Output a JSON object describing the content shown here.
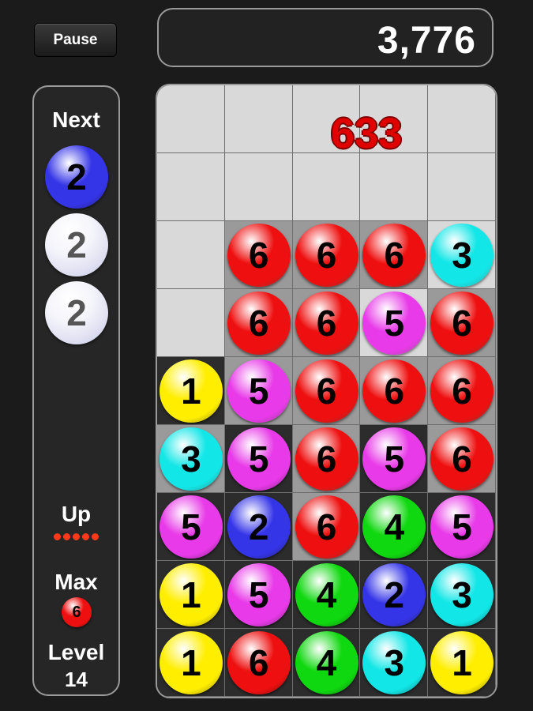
{
  "pause_label": "Pause",
  "score": "3,776",
  "popup_score": "633",
  "side": {
    "next_label": "Next",
    "next_balls": [
      "2",
      "2",
      "2"
    ],
    "up_label": "Up",
    "up_dots": 5,
    "max_label": "Max",
    "max_value": "6",
    "level_label": "Level",
    "level_value": "14"
  },
  "colors": {
    "1": "#ffee00",
    "2": "#3535e8",
    "3": "#12e6e6",
    "4": "#10d810",
    "5": "#e83ae8",
    "6": "#ee1010",
    "preview": "#dcdcf0"
  },
  "board": {
    "rows": 9,
    "cols": 5,
    "cells": [
      [
        null,
        null,
        null,
        null,
        null
      ],
      [
        null,
        null,
        null,
        null,
        null
      ],
      [
        null,
        "6",
        "6",
        "6",
        "3"
      ],
      [
        null,
        "6",
        "6",
        "5",
        "6"
      ],
      [
        "1",
        "5",
        "6",
        "6",
        "6"
      ],
      [
        "3",
        "5",
        "6",
        "5",
        "6"
      ],
      [
        "5",
        "2",
        "6",
        "4",
        "5"
      ],
      [
        "1",
        "5",
        "4",
        "2",
        "3"
      ],
      [
        "1",
        "6",
        "4",
        "3",
        "1"
      ]
    ],
    "cell_tones": [
      [
        "L",
        "L",
        "L",
        "L",
        "L"
      ],
      [
        "L",
        "L",
        "L",
        "L",
        "L"
      ],
      [
        "L",
        "M",
        "M",
        "M",
        "L"
      ],
      [
        "L",
        "M",
        "M",
        "L",
        "M"
      ],
      [
        "D",
        "M",
        "M",
        "M",
        "M"
      ],
      [
        "M",
        "D",
        "M",
        "D",
        "M"
      ],
      [
        "D",
        "D",
        "M",
        "D",
        "D"
      ],
      [
        "D",
        "D",
        "D",
        "D",
        "D"
      ],
      [
        "D",
        "D",
        "D",
        "D",
        "D"
      ]
    ],
    "tone_colors": {
      "L": "#d9d9d9",
      "M": "#9a9a9a",
      "D": "#2c2c2c"
    }
  }
}
